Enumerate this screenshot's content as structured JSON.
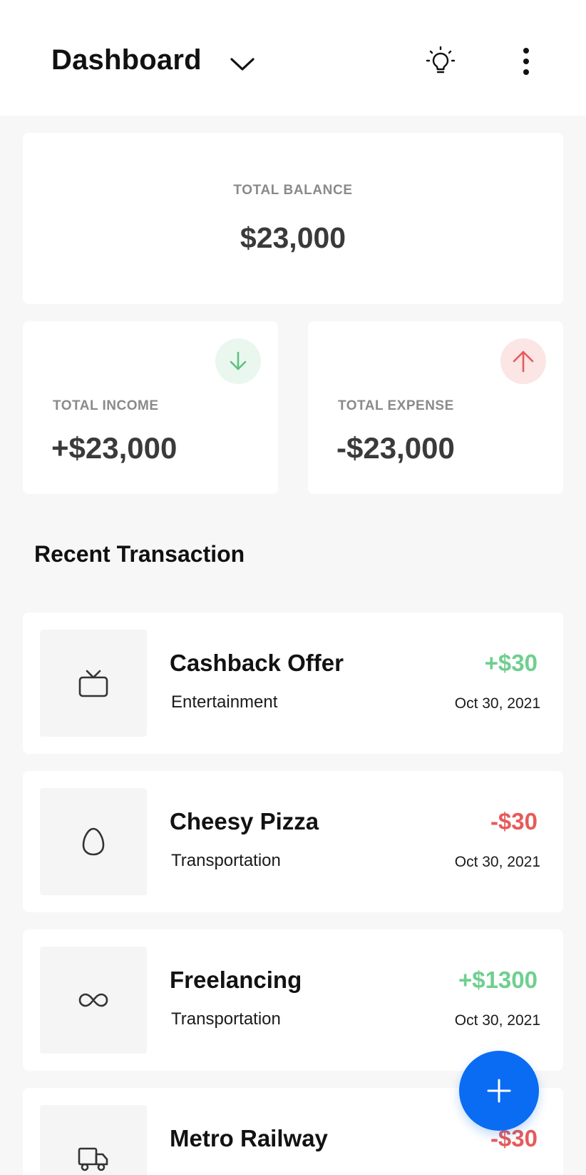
{
  "header": {
    "title": "Dashboard",
    "chevron_icon": "chevron-down-icon",
    "bulb_icon": "lightbulb-icon",
    "menu_icon": "kebab-menu-icon"
  },
  "balance": {
    "label": "TOTAL BALANCE",
    "value": "$23,000"
  },
  "income": {
    "label": "TOTAL INCOME",
    "value": "+$23,000",
    "icon": "arrow-down-icon",
    "color": "#6fcf8f"
  },
  "expense": {
    "label": "TOTAL EXPENSE",
    "value": "-$23,000",
    "icon": "arrow-up-icon",
    "color": "#e75a5a"
  },
  "recent": {
    "title": "Recent Transaction",
    "items": [
      {
        "name": "Cashback Offer",
        "category": "Entertainment",
        "amount": "+$30",
        "date": "Oct 30, 2021",
        "icon": "tv-icon",
        "type": "income"
      },
      {
        "name": "Cheesy Pizza",
        "category": "Transportation",
        "amount": "-$30",
        "date": "Oct 30, 2021",
        "icon": "egg-icon",
        "type": "expense"
      },
      {
        "name": "Freelancing",
        "category": "Transportation",
        "amount": "+$1300",
        "date": "Oct 30, 2021",
        "icon": "infinity-icon",
        "type": "income"
      },
      {
        "name": "Metro Railway",
        "category": "",
        "amount": "-$30",
        "date": "",
        "icon": "truck-icon",
        "type": "expense"
      }
    ]
  },
  "fab": {
    "icon": "plus-icon",
    "color": "#0a6cf2"
  }
}
